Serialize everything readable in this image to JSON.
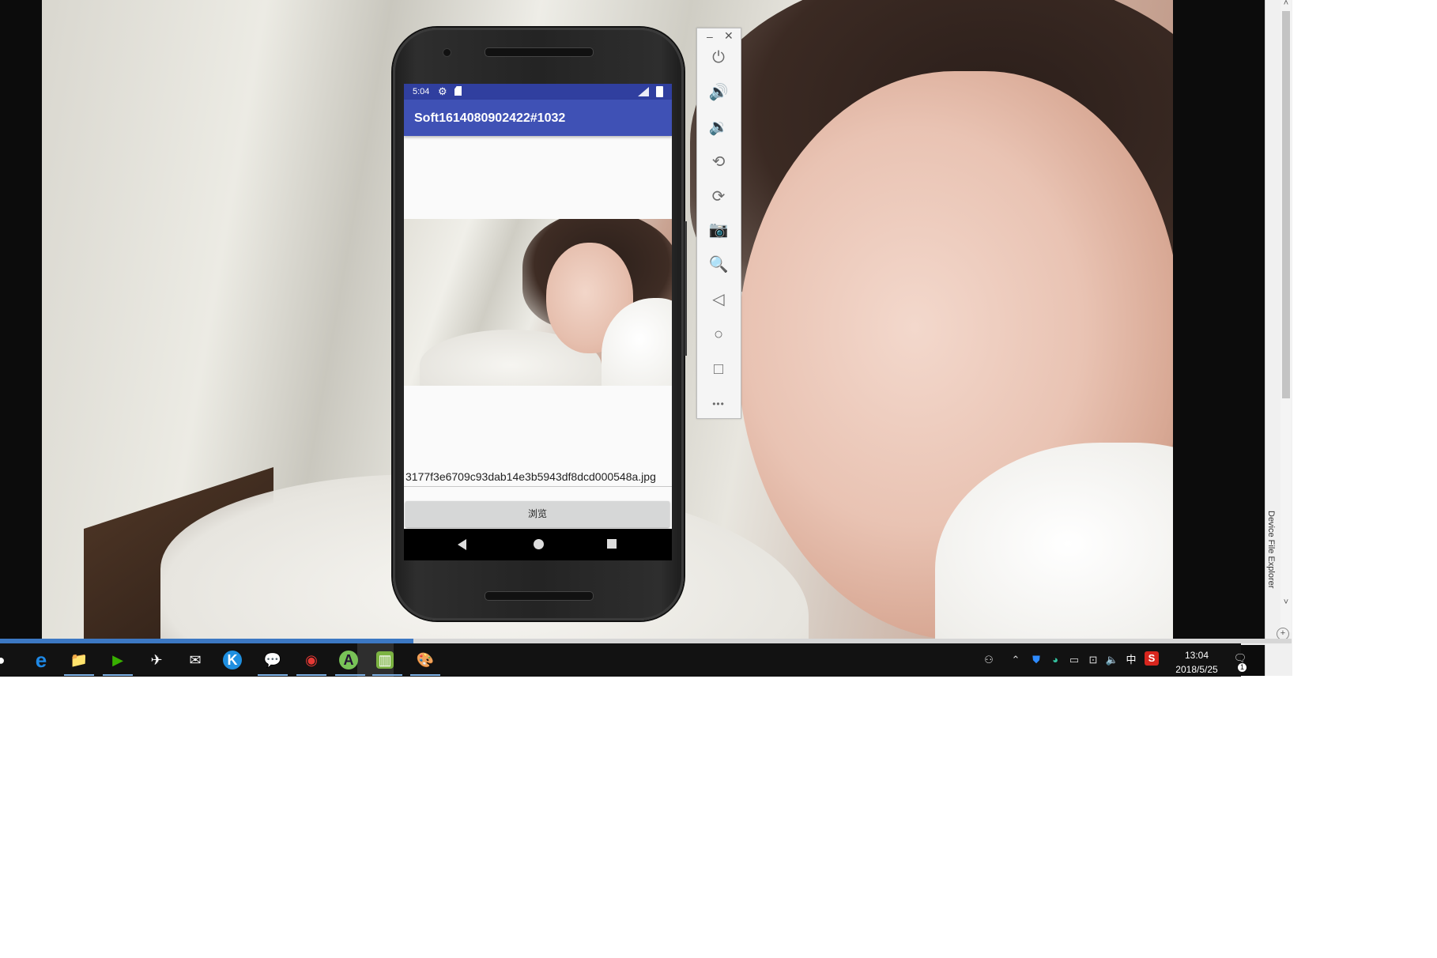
{
  "emulator": {
    "status_time": "5:04",
    "icons": {
      "settings": "gear-icon",
      "sd_card": "sd-card-icon",
      "signal": "signal-icon",
      "battery": "battery-icon"
    },
    "app_title": "Soft1614080902422#1032",
    "filename_value": "3177f3e6709c93dab14e3b5943df8dcd000548a.jpg",
    "browse_button_label": "浏览",
    "colors": {
      "status_bar": "#303f9f",
      "app_bar": "#3f51b5"
    }
  },
  "emulator_toolbar": {
    "minimize": "–",
    "close": "✕",
    "buttons": [
      {
        "name": "power-icon",
        "glyph": "⏻"
      },
      {
        "name": "volume-up-icon",
        "glyph": "🔊"
      },
      {
        "name": "volume-down-icon",
        "glyph": "🔉"
      },
      {
        "name": "rotate-left-icon",
        "glyph": "⟲"
      },
      {
        "name": "rotate-right-icon",
        "glyph": "⟳"
      },
      {
        "name": "camera-icon",
        "glyph": "📷"
      },
      {
        "name": "zoom-icon",
        "glyph": "🔍"
      },
      {
        "name": "back-icon",
        "glyph": "◁"
      },
      {
        "name": "home-icon",
        "glyph": "○"
      },
      {
        "name": "overview-icon",
        "glyph": "□"
      },
      {
        "name": "more-icon",
        "glyph": "•••"
      }
    ]
  },
  "ide": {
    "side_tab": "Device File Explorer",
    "progress_fraction": 0.32
  },
  "taskbar": {
    "apps": [
      {
        "name": "edge-icon",
        "glyph": "e",
        "color": "#1e88e5"
      },
      {
        "name": "file-explorer-icon",
        "glyph": "📁",
        "color": "#f4c542"
      },
      {
        "name": "media-player-icon",
        "glyph": "▶",
        "color": "#38b000"
      },
      {
        "name": "mail-app-icon",
        "glyph": "✈",
        "color": "#ffffff"
      },
      {
        "name": "mail-icon",
        "glyph": "✉",
        "color": "#ffffff"
      },
      {
        "name": "k-app-icon",
        "glyph": "K",
        "color": "#1f8fe0"
      },
      {
        "name": "wechat-icon",
        "glyph": "💬",
        "color": "#09bb07"
      },
      {
        "name": "chrome-icon",
        "glyph": "◉",
        "color": "#e53935"
      },
      {
        "name": "android-studio-icon",
        "glyph": "A",
        "color": "#78c257"
      },
      {
        "name": "emulator-icon",
        "glyph": "▥",
        "color": "#7cb342"
      },
      {
        "name": "paint-icon",
        "glyph": "🎨",
        "color": "#ffffff"
      }
    ],
    "tray": {
      "ime": "中",
      "time": "13:04",
      "date": "2018/5/25",
      "notification_count": "1"
    }
  }
}
